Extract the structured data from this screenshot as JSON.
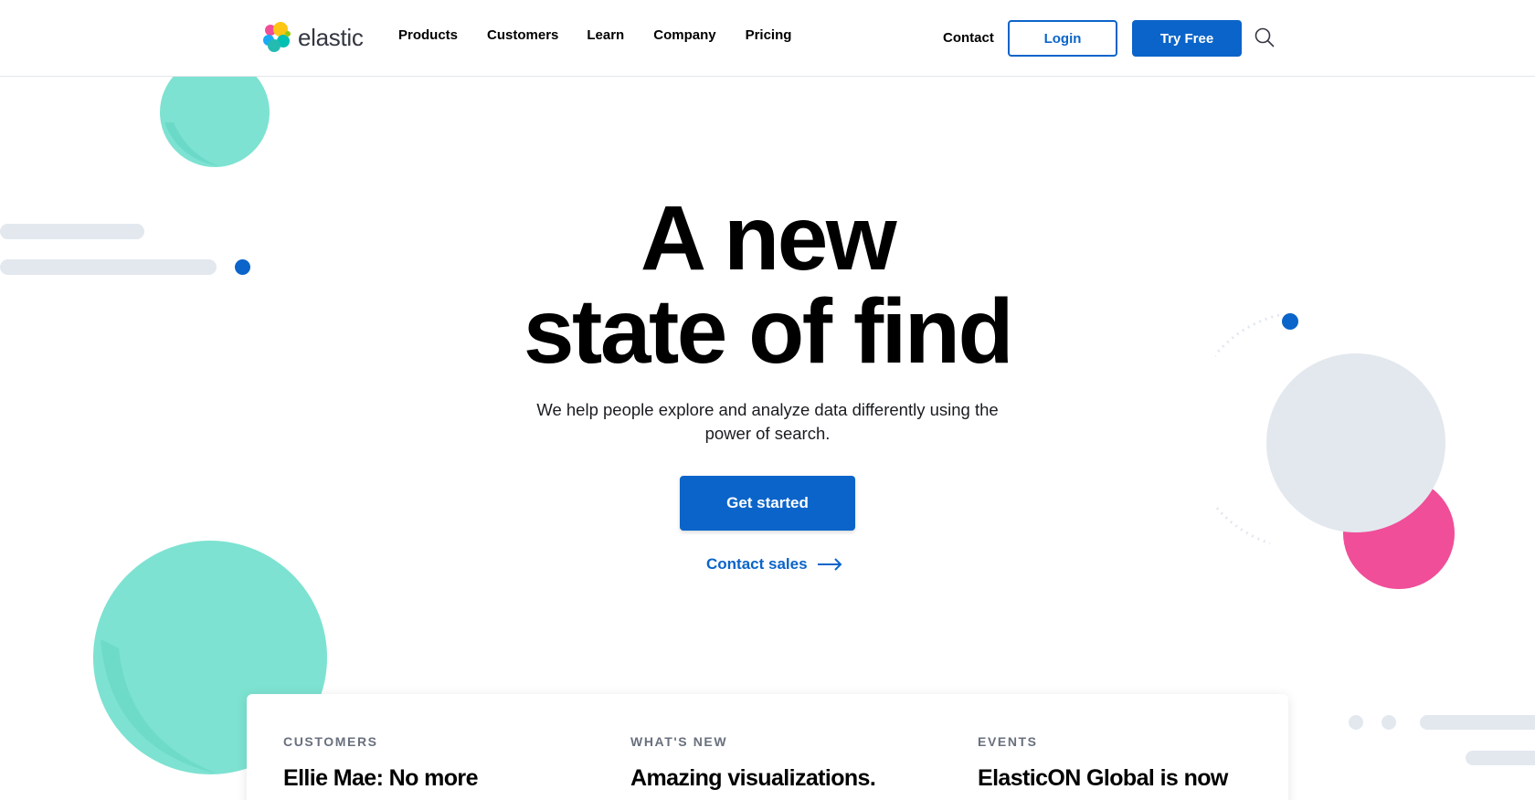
{
  "brand": {
    "name": "elastic"
  },
  "nav": {
    "items": [
      {
        "label": "Products"
      },
      {
        "label": "Customers"
      },
      {
        "label": "Learn"
      },
      {
        "label": "Company"
      },
      {
        "label": "Pricing"
      }
    ],
    "contact": "Contact",
    "login": "Login",
    "try_free": "Try Free",
    "search_icon": "search-icon"
  },
  "hero": {
    "title_line1": "A new",
    "title_line2": "state of find",
    "subtitle": "We help people explore and analyze data differently using the power of search.",
    "cta_primary": "Get started",
    "cta_secondary": "Contact sales"
  },
  "cards": [
    {
      "label": "CUSTOMERS",
      "title": "Ellie Mae: No more"
    },
    {
      "label": "WHAT'S NEW",
      "title": "Amazing visualizations."
    },
    {
      "label": "EVENTS",
      "title": "ElasticON Global is now"
    }
  ],
  "colors": {
    "accent": "#0b64c9",
    "teal": "#7de2d1",
    "pink": "#f04e98",
    "light_gray": "#e3e8ef"
  }
}
